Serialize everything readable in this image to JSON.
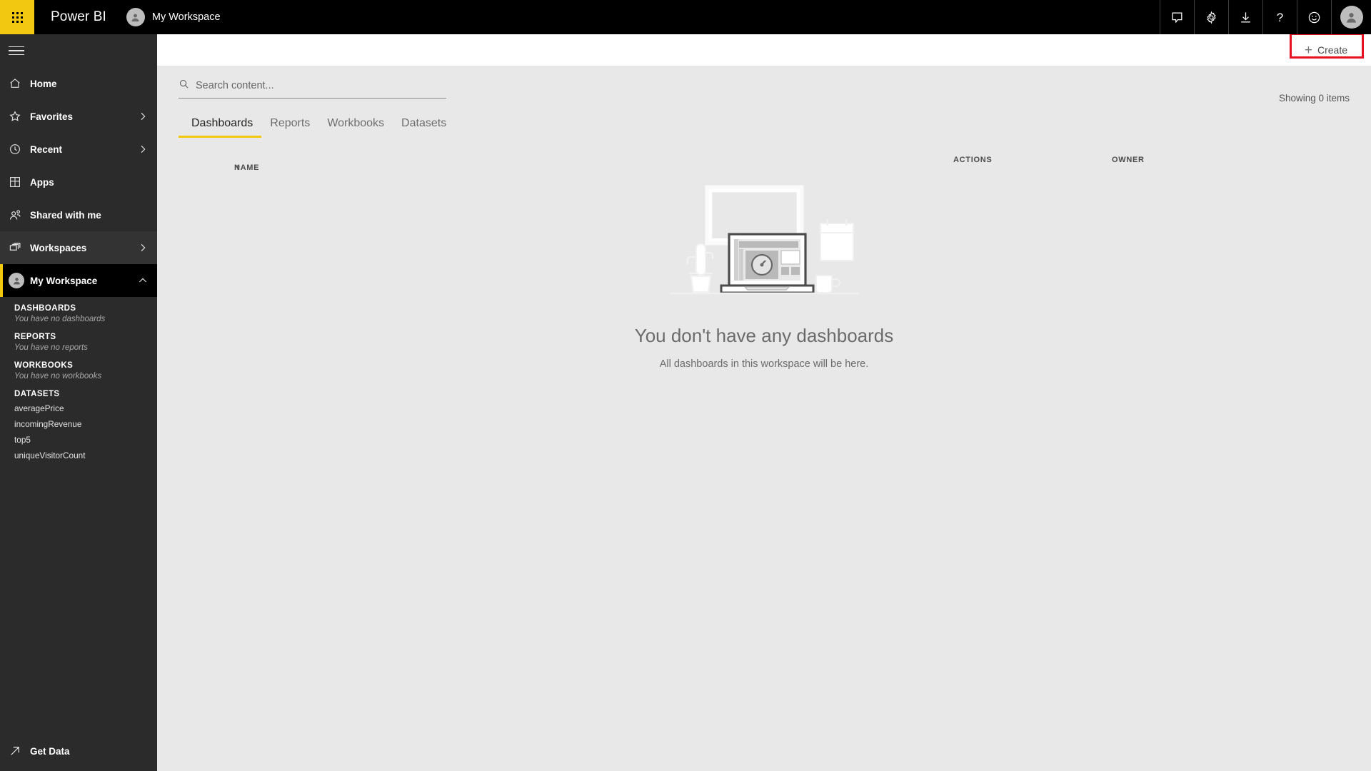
{
  "topbar": {
    "waffle_icon": "app-launcher-waffle-icon",
    "brand": "Power BI",
    "workspace_chip": {
      "avatar_icon": "person-avatar-icon",
      "label": "My Workspace"
    },
    "icons": [
      {
        "name": "comment-icon",
        "glyph": "speech-bubble"
      },
      {
        "name": "settings-gear-icon",
        "glyph": "gear"
      },
      {
        "name": "download-icon",
        "glyph": "download-arrow"
      },
      {
        "name": "help-icon",
        "glyph": "?"
      },
      {
        "name": "feedback-smiley-icon",
        "glyph": "smiley"
      }
    ],
    "account_avatar_icon": "account-avatar-icon"
  },
  "sidebar": {
    "hamburger_label": "Navigation menu",
    "items": [
      {
        "label": "Home",
        "icon": "home-icon",
        "chevron": "",
        "state": "normal"
      },
      {
        "label": "Favorites",
        "icon": "star-icon",
        "chevron": "right",
        "state": "normal"
      },
      {
        "label": "Recent",
        "icon": "clock-icon",
        "chevron": "right",
        "state": "normal"
      },
      {
        "label": "Apps",
        "icon": "apps-grid-icon",
        "chevron": "",
        "state": "normal"
      },
      {
        "label": "Shared with me",
        "icon": "people-icon",
        "chevron": "",
        "state": "normal"
      },
      {
        "label": "Workspaces",
        "icon": "workspaces-icon",
        "chevron": "right",
        "state": "hovered"
      },
      {
        "label": "My Workspace",
        "icon": "person-avatar-icon",
        "chevron": "up",
        "state": "selected"
      }
    ],
    "sections": [
      {
        "heading": "DASHBOARDS",
        "empty_text": "You have no dashboards",
        "items": []
      },
      {
        "heading": "REPORTS",
        "empty_text": "You have no reports",
        "items": []
      },
      {
        "heading": "WORKBOOKS",
        "empty_text": "You have no workbooks",
        "items": []
      },
      {
        "heading": "DATASETS",
        "empty_text": "",
        "items": [
          "averagePrice",
          "incomingRevenue",
          "top5",
          "uniqueVisitorCount"
        ]
      }
    ],
    "get_data": {
      "label": "Get Data",
      "icon": "arrow-up-right-icon"
    }
  },
  "commandbar": {
    "create_label": "Create",
    "create_icon": "plus-icon",
    "highlight_color": "#e81123"
  },
  "main": {
    "search": {
      "placeholder": "Search content...",
      "value": "",
      "icon": "search-icon"
    },
    "tabs": [
      {
        "label": "Dashboards",
        "active": true
      },
      {
        "label": "Reports",
        "active": false
      },
      {
        "label": "Workbooks",
        "active": false
      },
      {
        "label": "Datasets",
        "active": false
      }
    ],
    "showing_text": "Showing 0 items",
    "columns": {
      "name": "NAME",
      "name_sort_icon": "sort-ascending-arrow-icon",
      "actions": "ACTIONS",
      "owner": "OWNER"
    },
    "empty_state": {
      "illustration": "empty-dashboard-desk-illustration",
      "title": "You don't have any dashboards",
      "subtitle": "All dashboards in this workspace will be here."
    }
  },
  "colors": {
    "brand_yellow": "#f2c811",
    "topbar_black": "#000000",
    "sidebar_gray": "#2b2b2b",
    "content_gray": "#e8e8e8",
    "highlight_red": "#e81123"
  }
}
